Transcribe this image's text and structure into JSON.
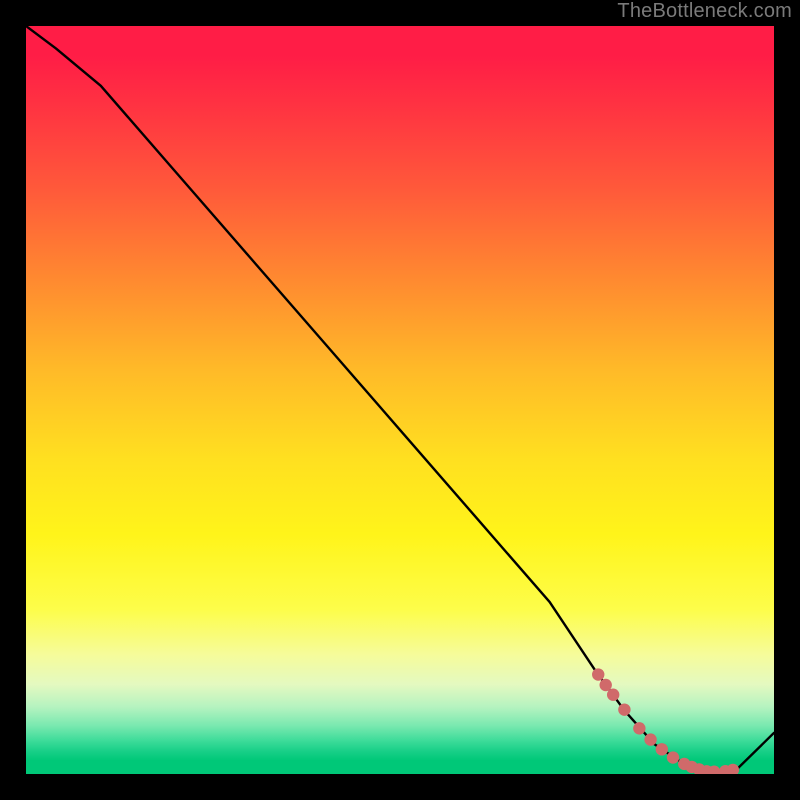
{
  "watermark": "TheBottleneck.com",
  "chart_data": {
    "type": "line",
    "title": "",
    "xlabel": "",
    "ylabel": "",
    "xlim": [
      0,
      100
    ],
    "ylim": [
      0,
      100
    ],
    "x": [
      0,
      4,
      10,
      20,
      30,
      40,
      50,
      60,
      70,
      76,
      80,
      84,
      88,
      92,
      95,
      100
    ],
    "y": [
      100,
      97,
      92,
      80.5,
      69,
      57.5,
      46,
      34.5,
      23,
      14,
      8.5,
      4,
      1.3,
      0.3,
      0.6,
      5.5
    ],
    "marker_points_x": [
      76.5,
      77.5,
      78.5,
      80,
      82,
      83.5,
      85,
      86.5,
      88,
      89,
      90,
      91,
      92,
      93.5,
      94.5
    ],
    "marker_points_y": [
      13.3,
      11.9,
      10.6,
      8.6,
      6.1,
      4.6,
      3.3,
      2.2,
      1.35,
      0.95,
      0.6,
      0.35,
      0.3,
      0.38,
      0.55
    ],
    "marker_color": "#d06a6a",
    "line_color": "#000000"
  }
}
